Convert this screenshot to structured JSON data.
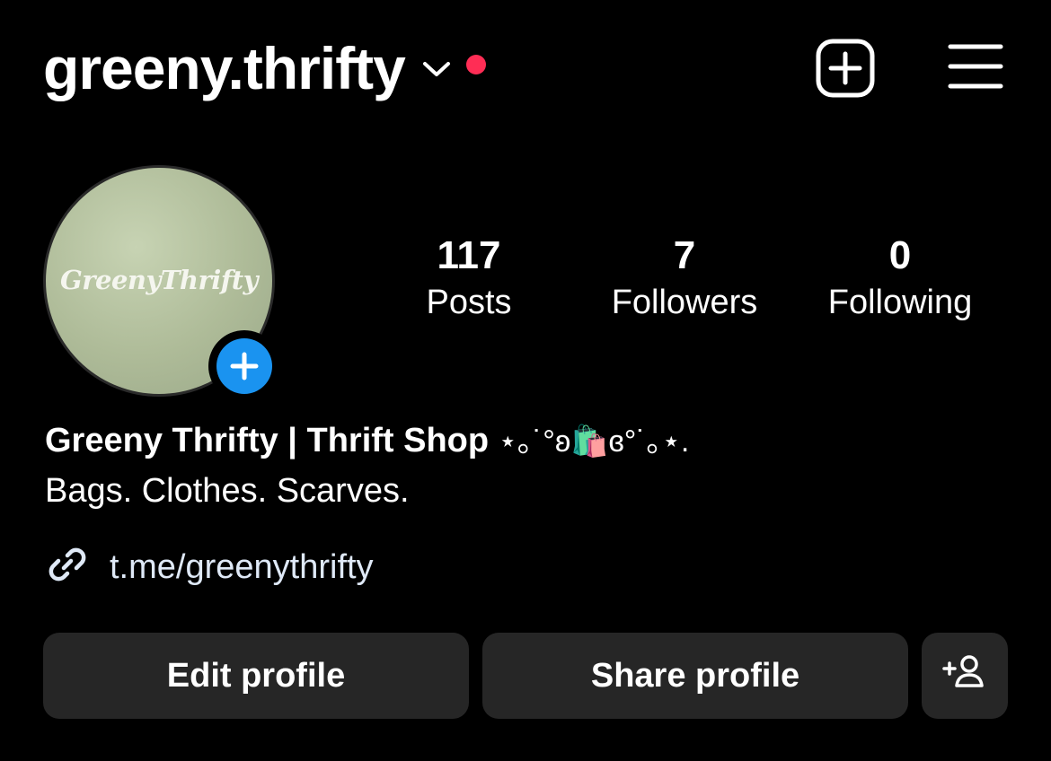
{
  "header": {
    "username": "greeny.thrifty",
    "notification_dot_color": "#ff2d55",
    "icons": [
      "chevron-down-icon",
      "new-post-icon",
      "menu-icon"
    ]
  },
  "profile": {
    "avatar_text": "GreenyThrifty",
    "add_story_color": "#1a93f0",
    "stats": [
      {
        "value": "117",
        "label": "Posts"
      },
      {
        "value": "7",
        "label": "Followers"
      },
      {
        "value": "0",
        "label": "Following"
      }
    ],
    "display_name": "Greeny Thrifty | Thrift Shop",
    "name_decoration_left": "⋆｡˙°ʚ",
    "name_emoji": "🛍️",
    "name_decoration_right": "ɞ°˙｡⋆.",
    "bio": "Bags. Clothes. Scarves.",
    "link": "t.me/greenythrifty"
  },
  "actions": {
    "edit_label": "Edit profile",
    "share_label": "Share profile",
    "add_friend_icon": "add-person-icon"
  }
}
